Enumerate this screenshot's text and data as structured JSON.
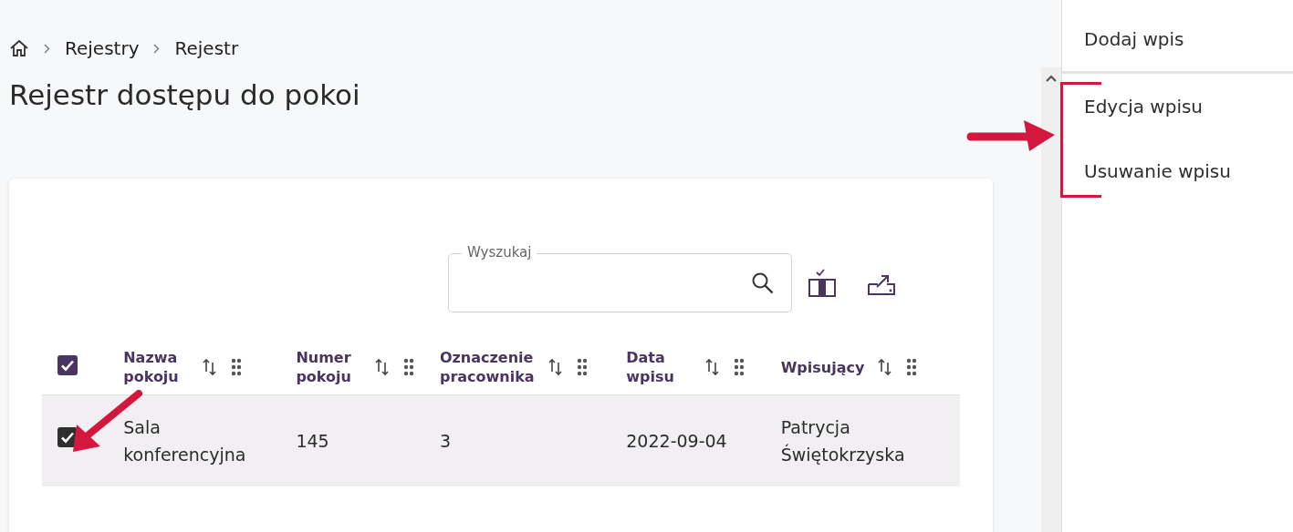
{
  "breadcrumb": [
    {
      "label": "Rejestry"
    },
    {
      "label": "Rejestr"
    }
  ],
  "page_title": "Rejestr dostępu do pokoi",
  "search": {
    "label": "Wyszukaj"
  },
  "table": {
    "select_all_checked": true,
    "columns": [
      {
        "label": "Nazwa pokoju"
      },
      {
        "label": "Numer pokoju"
      },
      {
        "label": "Oznaczenie pracownika"
      },
      {
        "label": "Data wpisu"
      },
      {
        "label": "Wpisujący"
      }
    ],
    "rows": [
      {
        "selected": true,
        "checked": true,
        "cells": [
          "Sala konferencyjna",
          "145",
          "3",
          "2022-09-04",
          "Patrycja Świętokrzyska"
        ]
      }
    ]
  },
  "actions_menu": {
    "items": [
      {
        "label": "Dodaj wpis",
        "divider_after": true
      },
      {
        "label": "Edycja wpisu",
        "divider_after": false
      },
      {
        "label": "Usuwanie wpisu",
        "divider_after": false
      }
    ]
  }
}
